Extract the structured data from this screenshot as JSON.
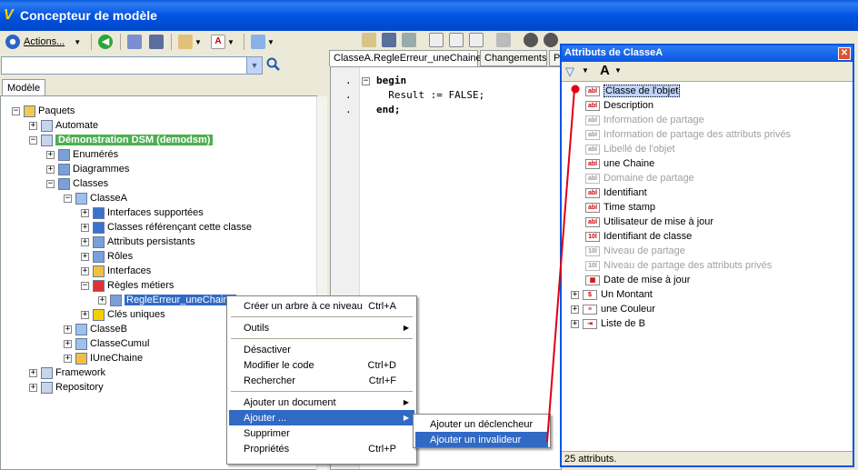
{
  "window": {
    "title": "Concepteur de modèle"
  },
  "toolbar": {
    "actions_label": "Actions..."
  },
  "search": {
    "value": ""
  },
  "left_tab": "Modèle",
  "tree": [
    {
      "label": "Paquets",
      "depth": 0,
      "exp": "−"
    },
    {
      "label": "Automate",
      "depth": 1,
      "exp": "+"
    },
    {
      "label": "Démonstration DSM (demodsm)",
      "depth": 1,
      "exp": "−",
      "highlight": "green"
    },
    {
      "label": "Enumérés",
      "depth": 2,
      "exp": "+"
    },
    {
      "label": "Diagrammes",
      "depth": 2,
      "exp": "+"
    },
    {
      "label": "Classes",
      "depth": 2,
      "exp": "−"
    },
    {
      "label": "ClasseA",
      "depth": 3,
      "exp": "−"
    },
    {
      "label": "Interfaces supportées",
      "depth": 4,
      "exp": "+"
    },
    {
      "label": "Classes référençant cette classe",
      "depth": 4,
      "exp": "+"
    },
    {
      "label": "Attributs persistants",
      "depth": 4,
      "exp": "+"
    },
    {
      "label": "Rôles",
      "depth": 4,
      "exp": "+"
    },
    {
      "label": "Interfaces",
      "depth": 4,
      "exp": "+"
    },
    {
      "label": "Règles métiers",
      "depth": 4,
      "exp": "−"
    },
    {
      "label": "RegleErreur_uneChaine",
      "depth": 5,
      "exp": "+",
      "highlight": "blue"
    },
    {
      "label": "Clés uniques",
      "depth": 4,
      "exp": "+"
    },
    {
      "label": "ClasseB",
      "depth": 3,
      "exp": "+"
    },
    {
      "label": "ClasseCumul",
      "depth": 3,
      "exp": "+"
    },
    {
      "label": "IUneChaine",
      "depth": 3,
      "exp": "+"
    },
    {
      "label": "Framework",
      "depth": 1,
      "exp": "+"
    },
    {
      "label": "Repository",
      "depth": 1,
      "exp": "+"
    }
  ],
  "editor_tabs": [
    "ClasseA.RegleErreur_uneChaine",
    "Changements",
    "P"
  ],
  "code_lines": [
    "begin",
    "  Result := FALSE;",
    "end;"
  ],
  "context_menu": [
    {
      "label": "Créer un arbre à ce niveau",
      "shortcut": "Ctrl+A"
    },
    {
      "sep": true
    },
    {
      "label": "Outils",
      "submenu": true
    },
    {
      "sep": true
    },
    {
      "label": "Désactiver"
    },
    {
      "label": "Modifier le code",
      "shortcut": "Ctrl+D"
    },
    {
      "label": "Rechercher",
      "shortcut": "Ctrl+F"
    },
    {
      "sep": true
    },
    {
      "label": "Ajouter un document",
      "submenu": true
    },
    {
      "label": "Ajouter ...",
      "submenu": true,
      "selected": true
    },
    {
      "label": "Supprimer"
    },
    {
      "label": "Propriétés",
      "shortcut": "Ctrl+P"
    }
  ],
  "submenu": [
    {
      "label": "Ajouter un déclencheur"
    },
    {
      "label": "Ajouter un invalideur",
      "selected": true
    }
  ],
  "attr_window": {
    "title": "Attributs de ClasseA",
    "status": "25 attributs.",
    "items": [
      {
        "label": "Classe de l'objet",
        "icon": "abl",
        "grey": false,
        "selected": true
      },
      {
        "label": "Description",
        "icon": "abl",
        "grey": false
      },
      {
        "label": "Information de partage",
        "icon": "abl",
        "grey": true
      },
      {
        "label": "Information de partage des attributs privés",
        "icon": "abl",
        "grey": true
      },
      {
        "label": "Libellé de l'objet",
        "icon": "abl",
        "grey": true
      },
      {
        "label": "une Chaine",
        "icon": "abl",
        "grey": false
      },
      {
        "label": "Domaine de partage",
        "icon": "abl",
        "grey": true
      },
      {
        "label": "Identifiant",
        "icon": "abl",
        "grey": false
      },
      {
        "label": "Time stamp",
        "icon": "abl",
        "grey": false
      },
      {
        "label": "Utilisateur de mise à jour",
        "icon": "abl",
        "grey": false
      },
      {
        "label": "Identifiant de classe",
        "icon": "10l",
        "grey": false
      },
      {
        "label": "Niveau de partage",
        "icon": "10l",
        "grey": true
      },
      {
        "label": "Niveau de partage des attributs privés",
        "icon": "10l",
        "grey": true
      },
      {
        "label": "Date de mise à jour",
        "icon": "date",
        "grey": false
      },
      {
        "label": "Un Montant",
        "icon": "money",
        "grey": false,
        "exp": "+"
      },
      {
        "label": "une Couleur",
        "icon": "enum",
        "grey": false,
        "exp": "+"
      },
      {
        "label": "Liste de B",
        "icon": "list",
        "grey": false,
        "exp": "+"
      }
    ]
  }
}
